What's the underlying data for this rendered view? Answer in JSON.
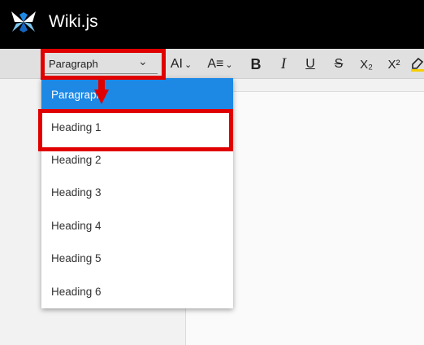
{
  "app": {
    "title": "Wiki.js"
  },
  "toolbar": {
    "style_select": {
      "value": "Paragraph"
    },
    "buttons": [
      "font-size",
      "heading-size",
      "bold",
      "italic",
      "underline",
      "strikethrough",
      "subscript",
      "superscript",
      "highlight"
    ],
    "glyphs": {
      "font_size": "AI",
      "heading_size": "A≡",
      "bold": "B",
      "italic": "I",
      "underline": "U",
      "strikethrough": "S",
      "subscript": "X₂",
      "superscript": "X²"
    }
  },
  "dropdown": {
    "items": [
      {
        "label": "Paragraph",
        "selected": true
      },
      {
        "label": "Heading 1",
        "selected": false
      },
      {
        "label": "Heading 2",
        "selected": false
      },
      {
        "label": "Heading 3",
        "selected": false
      },
      {
        "label": "Heading 4",
        "selected": false
      },
      {
        "label": "Heading 5",
        "selected": false
      },
      {
        "label": "Heading 6",
        "selected": false
      }
    ]
  },
  "colors": {
    "header_bg": "#000000",
    "toolbar_bg": "#e0e0e0",
    "selected_bg": "#1e88e5",
    "annotation": "#e00000",
    "highlight_pen": "#f5d000"
  },
  "icons": {
    "logo": "wikijs-logo-icon",
    "chevron": "chevron-down-icon",
    "highlighter": "highlighter-icon"
  }
}
